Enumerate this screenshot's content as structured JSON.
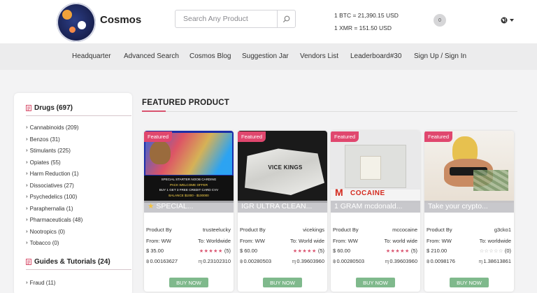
{
  "header": {
    "brand": "Cosmos",
    "search_placeholder": "Search Any Product",
    "btc_rate": "1 BTC = 21,390.15 USD",
    "xmr_rate": "1 XMR = 151.50 USD",
    "cart_count": "0"
  },
  "nav": [
    "Headquarter",
    "Advanced Search",
    "Cosmos Blog",
    "Suggestion Jar",
    "Vendors List",
    "Leaderboard#30",
    "Sign Up / Sign In"
  ],
  "sidebar": {
    "drugs_heading": "Drugs (697)",
    "drugs": [
      "Cannabinoids (209)",
      "Benzos (31)",
      "Stimulants (225)",
      "Opiates (55)",
      "Harm Reduction (1)",
      "Dissociatives (27)",
      "Psychedelics (100)",
      "Paraphernalia (1)",
      "Pharmaceuticals (48)",
      "Nootropics (0)",
      "Tobacco (0)"
    ],
    "guides_heading": "Guides & Tutorials (24)",
    "guides": [
      "Fraud (11)"
    ]
  },
  "featured": {
    "title": "FEATURED PRODUCT",
    "badge": "Featured",
    "product_by_label": "Product By",
    "buy_label": "BUY NOW",
    "cards": [
      {
        "title": "SPECIAL...",
        "vendor": "trusteelucky",
        "from": "From: WW",
        "to": "To: Worldwide",
        "price": "$ 35.00",
        "rating": "(5)",
        "btc": "0.00163627",
        "xmr": "0.23102310",
        "rated": true
      },
      {
        "title": "IGR ULTRA CLEAN...",
        "vendor": "vicekings",
        "from": "From: WW",
        "to": "To: World wide",
        "price": "$ 60.00",
        "rating": "(5)",
        "btc": "0.00280503",
        "xmr": "0.39603960",
        "rated": true
      },
      {
        "title": "1 GRAM mcdonald...",
        "vendor": "mccocaine",
        "from": "From: WW",
        "to": "To: world wide",
        "price": "$ 60.00",
        "rating": "(5)",
        "btc": "0.00280503",
        "xmr": "0.39603960",
        "rated": true
      },
      {
        "title": "Take your crypto...",
        "vendor": "g3cko1",
        "from": "From: WW",
        "to": "To: worldwide",
        "price": "$ 210.00",
        "rating": "(0)",
        "btc": "0.0098176",
        "xmr": "1.38613861",
        "rated": false
      }
    ]
  },
  "image_text": {
    "card1_banner1": "SPECIAL STARTER NOOB CARDING",
    "card1_banner2": "PACK WELCOME OFFER",
    "card1_banner3": "BUY 1 GET 3 FREE CREDIT CARD CVV",
    "card1_banner4": "BALANCE $1000 - $100000",
    "card2_logo": "VICE KINGS",
    "card3_logo": "COCAINE"
  },
  "colors": {
    "accent": "#e0476e",
    "buy": "#7fb98c",
    "divider": "#d9536f"
  }
}
